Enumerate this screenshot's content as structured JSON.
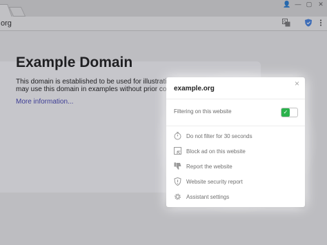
{
  "browser": {
    "url_text": "org",
    "window_controls": {
      "user": "👤",
      "minimize": "—",
      "maximize": "▢",
      "close": "✕"
    },
    "toolbar_icons": [
      "translate-icon",
      "adblock-shield-icon",
      "menu-icon"
    ]
  },
  "page": {
    "title": "Example Domain",
    "description_line1": "This domain is established to be used for illustrative exam",
    "description_line2": "may use this domain in examples without prior coordinat",
    "link_text": "More information..."
  },
  "popup": {
    "domain": "example.org",
    "close_glyph": "×",
    "filtering_label": "Filtering on this website",
    "filtering_enabled": true,
    "toggle_check": "✓",
    "items": [
      {
        "label": "Do not filter for 30 seconds",
        "icon": "timer-icon"
      },
      {
        "label": "Block ad on this website",
        "icon": "block-ad-icon"
      },
      {
        "label": "Report the website",
        "icon": "thumbs-down-icon"
      },
      {
        "label": "Website security report",
        "icon": "shield-icon"
      },
      {
        "label": "Assistant settings",
        "icon": "gear-icon"
      }
    ],
    "accent_color": "#2bb24c"
  }
}
